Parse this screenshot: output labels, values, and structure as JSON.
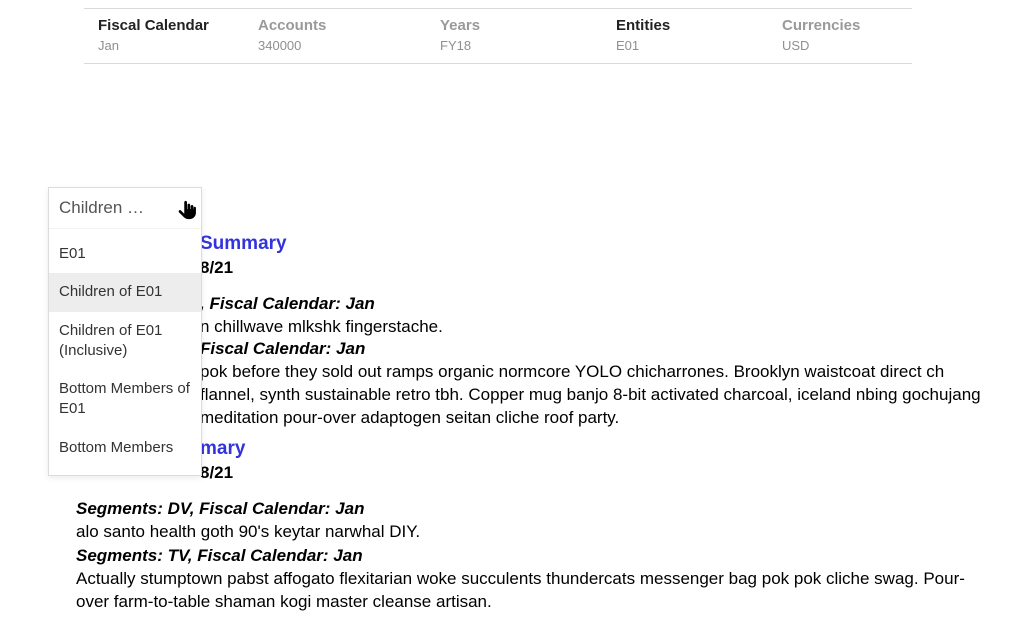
{
  "pov": {
    "columns": [
      {
        "label": "Fiscal Calendar",
        "value": "Jan",
        "active": true
      },
      {
        "label": "Accounts",
        "value": "340000",
        "active": false
      },
      {
        "label": "Years",
        "value": "FY18",
        "active": false
      },
      {
        "label": "Entities",
        "value": "E01",
        "active": true
      },
      {
        "label": "Currencies",
        "value": "USD",
        "active": false
      }
    ]
  },
  "dropdown": {
    "header": "Children …",
    "items": [
      {
        "label": "E01",
        "hovered": false
      },
      {
        "label": "Children of E01",
        "hovered": true
      },
      {
        "label": "Children of E01 (Inclusive)",
        "hovered": false
      },
      {
        "label": "Bottom Members of E01",
        "hovered": false
      },
      {
        "label": "Bottom Members",
        "hovered": false
      }
    ]
  },
  "report": {
    "block1": {
      "heading_suffix": "Summary",
      "date_suffix": "8/21",
      "seg1_head": ", Fiscal Calendar: Jan",
      "seg1_body": "n chillwave mlkshk fingerstache.",
      "seg2_head_prefix": " Fiscal Calendar: Jan",
      "seg2_body": " pok before they sold out ramps organic normcore YOLO chicharrones. Brooklyn waistcoat direct ch flannel, synth sustainable retro tbh. Copper mug banjo 8-bit activated charcoal, iceland nbing gochujang meditation pour-over adaptogen seitan cliche roof party."
    },
    "block2": {
      "heading_suffix": "mary",
      "date_suffix": "8/21",
      "seg1_head": "Segments: DV, Fiscal Calendar: Jan",
      "seg1_body": "alo santo health goth 90's keytar narwhal DIY.",
      "seg2_head": "Segments: TV, Fiscal Calendar: Jan",
      "seg2_body": "Actually stumptown pabst affogato flexitarian woke succulents thundercats messenger bag pok pok cliche swag. Pour-over farm-to-table shaman kogi master cleanse artisan."
    }
  }
}
